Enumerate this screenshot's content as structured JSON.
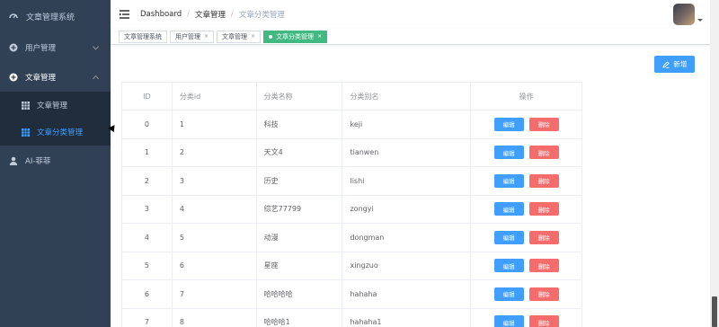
{
  "sidebar": {
    "logo_title": "文章管理系统",
    "menu": [
      {
        "label": "用户管理",
        "icon": "plus-circle-icon",
        "expanded": false
      },
      {
        "label": "文章管理",
        "icon": "plus-circle-icon",
        "expanded": true,
        "children": [
          {
            "label": "文章管理",
            "icon": "grid-icon",
            "active": false
          },
          {
            "label": "文章分类管理",
            "icon": "grid-icon",
            "active": true
          }
        ]
      },
      {
        "label": "AI-菲菲",
        "icon": "user-icon",
        "expanded": false
      }
    ]
  },
  "navbar": {
    "breadcrumb": [
      "Dashboard",
      "文章管理",
      "文章分类管理"
    ],
    "separator": "/"
  },
  "tags": [
    {
      "label": "文章管理系统",
      "closable": false,
      "active": false
    },
    {
      "label": "用户管理",
      "closable": true,
      "active": false
    },
    {
      "label": "文章管理",
      "closable": true,
      "active": false
    },
    {
      "label": "文章分类管理",
      "closable": true,
      "active": true
    }
  ],
  "tag_close_glyph": "×",
  "toolbar": {
    "add_label": "新增"
  },
  "table": {
    "headers": [
      "ID",
      "分类id",
      "分类名称",
      "分类别名",
      "操作"
    ],
    "edit_label": "编辑",
    "delete_label": "删除",
    "rows": [
      [
        "0",
        "1",
        "科技",
        "keji"
      ],
      [
        "1",
        "2",
        "天文4",
        "tianwen"
      ],
      [
        "2",
        "3",
        "历史",
        "lishi"
      ],
      [
        "3",
        "4",
        "综艺77799",
        "zongyi"
      ],
      [
        "4",
        "5",
        "动漫",
        "dongman"
      ],
      [
        "5",
        "6",
        "星座",
        "xingzuo"
      ],
      [
        "6",
        "7",
        "哈哈哈哈",
        "hahaha"
      ],
      [
        "7",
        "8",
        "哈哈哈1",
        "hahaha1"
      ]
    ]
  },
  "colors": {
    "sidebar_bg": "#304156",
    "submenu_bg": "#1f2d3d",
    "primary": "#409eff",
    "danger": "#f56c6c",
    "tag_active": "#42b983"
  }
}
